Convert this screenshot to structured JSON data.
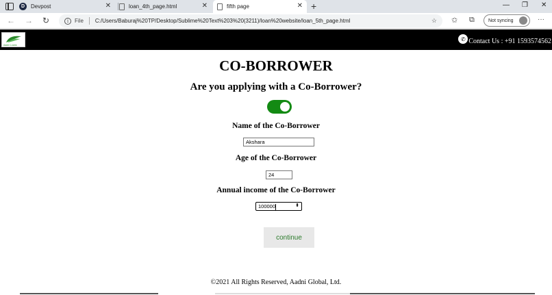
{
  "browser": {
    "tabs": [
      {
        "title": "Devpost",
        "favicon": "D"
      },
      {
        "title": "loan_4th_page.html",
        "favicon": ""
      },
      {
        "title": "fifth page",
        "favicon": ""
      }
    ],
    "active_tab": 2,
    "address": {
      "scheme_label": "File",
      "url": "C:/Users/Baburaj%20TP/Desktop/Sublime%20Text%203%20(3211)/loan%20website/loan_5th_page.html"
    },
    "profile": {
      "label": "Not syncing"
    },
    "colors": {
      "tabstrip": "#dfe3e8",
      "omnibox": "#f1f3f4"
    }
  },
  "header": {
    "logo_text": "Aadni Loans",
    "contact": "Contact Us : +91 1593574562",
    "background": "#000000"
  },
  "form": {
    "title": "CO-BORROWER",
    "question": "Are you applying with a Co-Borrower?",
    "toggle_on": true,
    "toggle_color": "#138a13",
    "name_label": "Name of the Co-Borrower",
    "name_value": "Akshara",
    "age_label": "Age of the Co-Borrower",
    "age_value": "24",
    "income_label": "Annual income of the Co-Borrower",
    "income_value": "100000",
    "continue_label": "continue"
  },
  "footer": {
    "text": "©2021 All Rights Reserved, Aadni Global, Ltd."
  }
}
